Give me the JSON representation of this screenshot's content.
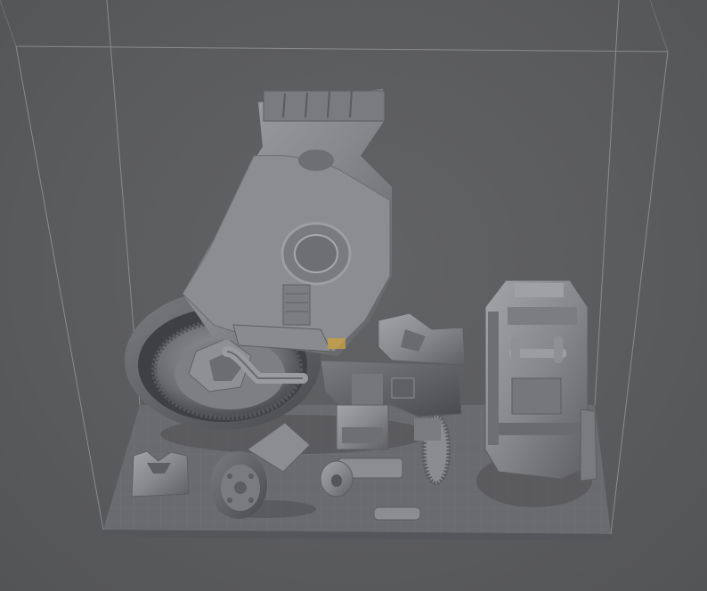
{
  "viewport": {
    "background_color": "#5a5b5d",
    "build_volume_color": "#8a8b8e",
    "plate_color": "#6a6b6e",
    "model_color": "#8e8f92",
    "highlight_color": "#c8a040"
  },
  "scene": {
    "objects": [
      "build-volume",
      "build-plate",
      "wheel-assembly",
      "rear-armor-panel",
      "bracket-part",
      "hub-part",
      "piston-part",
      "rod-part",
      "gear-part",
      "small-block-part",
      "hinge-part",
      "engine-block-part"
    ]
  }
}
